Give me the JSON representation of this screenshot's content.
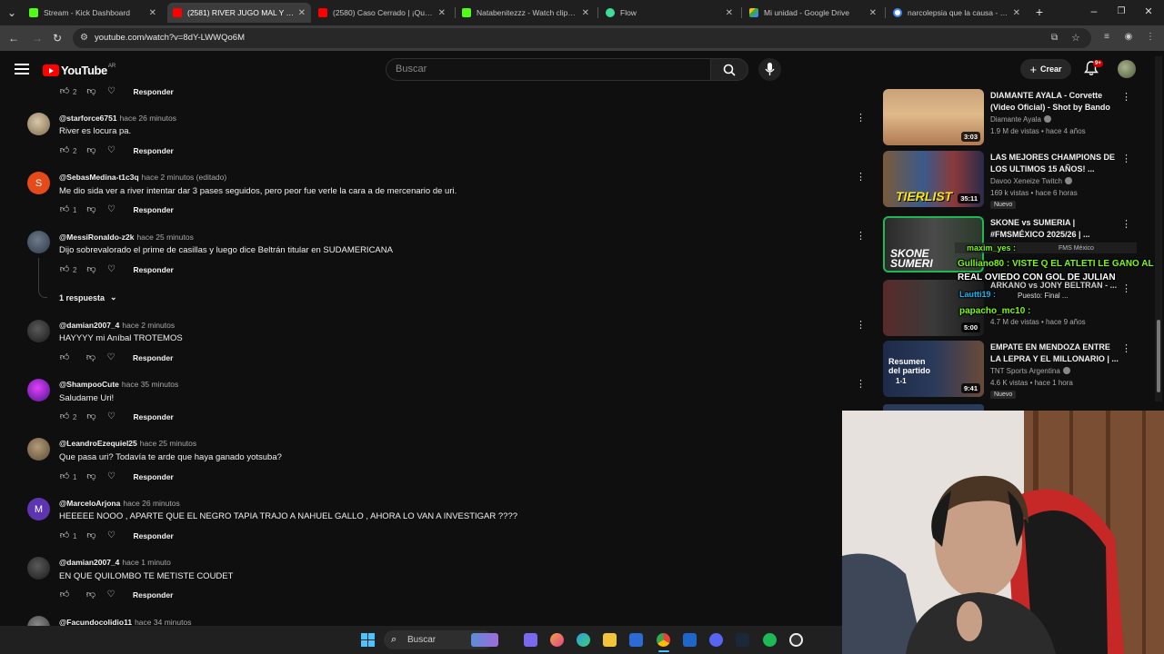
{
  "browser": {
    "tabs": [
      {
        "label": "Stream - Kick Dashboard",
        "active": false
      },
      {
        "label": "(2581) RIVER JUGO MAL Y EMP",
        "active": true
      },
      {
        "label": "(2580) Caso Cerrado | ¡Qué rica",
        "active": false
      },
      {
        "label": "Natabenitezzz - Watch clips on",
        "active": false
      },
      {
        "label": "Flow",
        "active": false
      },
      {
        "label": "Mi unidad - Google Drive",
        "active": false
      },
      {
        "label": "narcolepsia que la causa - Busc",
        "active": false
      }
    ],
    "url": "youtube.com/watch?v=8dY-LWWQo6M"
  },
  "youtube": {
    "logo_word": "YouTube",
    "region": "AR",
    "search_placeholder": "Buscar",
    "create_label": "Crear",
    "notif_badge": "9+"
  },
  "comments": [
    {
      "handle": "",
      "time": "",
      "text": "",
      "likes": "2",
      "reply": "Responder"
    },
    {
      "handle": "@starforce6751",
      "time": "hace 26 minutos",
      "text": "River es locura pa.",
      "likes": "2",
      "reply": "Responder"
    },
    {
      "handle": "@SebasMedina-t1c3q",
      "time": "hace 2 minutos (editado)",
      "text": "Me dio sida ver a river intentar dar 3 pases seguidos, pero peor fue verle la cara a de mercenario de uri.",
      "likes": "1",
      "reply": "Responder"
    },
    {
      "handle": "@MessiRonaldo-z2k",
      "time": "hace 25 minutos",
      "text": "Dijo sobrevalorado el prime de casillas y luego dice Beltrán titular en SUDAMERICANA",
      "likes": "2",
      "reply": "Responder"
    },
    {
      "handle": "@damian2007_4",
      "time": "hace 2 minutos",
      "text": "HAYYYY mi Aníbal TROTEMOS",
      "likes": "",
      "reply": "Responder"
    },
    {
      "handle": "@ShampooCute",
      "time": "hace 35 minutos",
      "text": "Saludame Uri!",
      "likes": "2",
      "reply": "Responder"
    },
    {
      "handle": "@LeandroEzequiel25",
      "time": "hace 25 minutos",
      "text": "Que pasa uri? Todavía te arde que haya ganado yotsuba?",
      "likes": "1",
      "reply": "Responder"
    },
    {
      "handle": "@MarceloArjona",
      "time": "hace 26 minutos",
      "text": "HEEEEE NOOO , APARTE QUE EL NEGRO TAPIA TRAJO A NAHUEL GALLO , AHORA LO VAN A INVESTIGAR ????",
      "likes": "1",
      "reply": "Responder"
    },
    {
      "handle": "@damian2007_4",
      "time": "hace 1 minuto",
      "text": "EN QUE QUILOMBO TE METISTE COUDET",
      "likes": "",
      "reply": "Responder"
    },
    {
      "handle": "@Facundocolidio11",
      "time": "hace 34 minutos",
      "text": "",
      "likes": "",
      "reply": ""
    }
  ],
  "replies_toggle": "1 respuesta",
  "sidebar_videos": [
    {
      "title": "DIAMANTE AYALA - Corvette (Video Oficial) - Shot by Bando",
      "channel": "Diamante Ayala",
      "meta": "1.9 M de vistas • hace 4 años",
      "duration": "3:03",
      "badge": ""
    },
    {
      "title": "LAS MEJORES CHAMPIONS DE LOS ULTIMOS 15 AÑOS! ...",
      "channel": "Davoo Xeneize Twitch",
      "meta": "169 k vistas • hace 6 horas",
      "duration": "35:11",
      "badge": "Nuevo"
    },
    {
      "title": "SKONE vs SUMERIA | #FMSMÉXICO 2025/26 | ...",
      "channel": "FMS México",
      "meta": "",
      "duration": "",
      "badge": ""
    },
    {
      "title": "ARKANO vs JONY BELTRAN - ...",
      "channel": "",
      "meta": "4.7 M de vistas • hace 9 años",
      "duration": "5:00",
      "badge": ""
    },
    {
      "title": "EMPATE EN MENDOZA ENTRE LA LEPRA Y EL MILLONARIO | ...",
      "channel": "TNT Sports Argentina",
      "meta": "4.6 K vistas • hace 1 hora",
      "duration": "9:41",
      "badge": "Nuevo"
    }
  ],
  "thumb_texts": {
    "tierlist": "TIERLIST",
    "skone": "SKONE",
    "sumeria": "SUMERI",
    "resumen1": "Resumen",
    "resumen2": "del partido",
    "score": "1-1"
  },
  "chat_overlay": [
    {
      "text": "maxim_yes :"
    },
    {
      "text": "Gulliano80 : VISTE Q EL ATLETI LE GANO AL"
    },
    {
      "text": "REAL OVIEDO CON GOL DE JULIAN"
    },
    {
      "text": "Lautti19 :"
    },
    {
      "text": "papacho_mc10 :"
    }
  ],
  "partial_texts": {
    "puesto": "Puesto: Final ..."
  },
  "taskbar": {
    "search_label": "Buscar"
  },
  "colors": {
    "accent": "#ff0000",
    "bg": "#0f0f0f",
    "chat_green": "#7CFC00"
  }
}
